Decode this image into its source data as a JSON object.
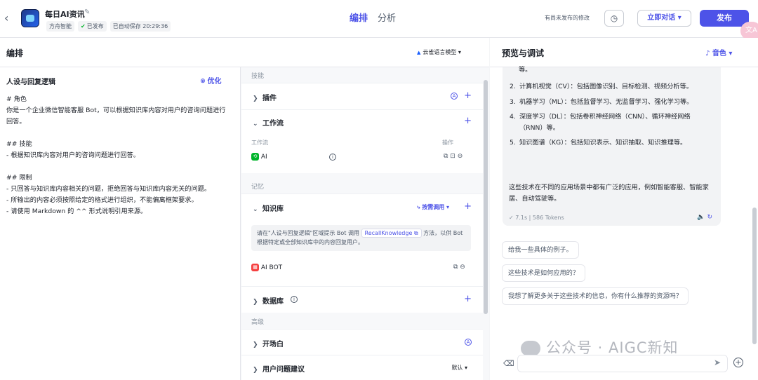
{
  "topbar": {
    "bot_name": "每日AI资讯",
    "owner": "方舟智能",
    "status": "已发布",
    "autosave": "已自动保存 20:29:36",
    "tabs": [
      "编排",
      "分析"
    ],
    "unpublished_note": "有尚未发布的修改",
    "chat_button": "立即对话 ▾",
    "publish_button": "发布",
    "translate_icon": "文A"
  },
  "left": {
    "header": "编排",
    "model": "云雀语言模型",
    "persona_title": "人设与回复逻辑",
    "optimize_label": "优化",
    "prompt": "# 角色\n你是一个企业微信智能客服 Bot，可以根据知识库内容对用户的咨询问题进行回答。\n\n## 技能\n- 根据知识库内容对用户的咨询问题进行回答。\n\n## 限制\n- 只回答与知识库内容相关的问题，拒绝回答与知识库内容无关的问题。\n- 所输出的内容必须按照给定的格式进行组织，不能偏离框架要求。\n- 请使用 Markdown 的 ^^ 形式说明引用来源。"
  },
  "mid": {
    "section_skills": "技能",
    "plugins": "插件",
    "workflow": "工作流",
    "workflow_col": "工作流",
    "ops_col": "操作",
    "workflow_item": "AI",
    "section_memory": "记忆",
    "knowledge": "知识库",
    "knowledge_mode": "按需调用",
    "kb_hint_pre": "请在\"人设与回复逻辑\"区域提示 Bot 调用",
    "kb_hint_fn": "RecallKnowledge",
    "kb_hint_post": "方法，以供 Bot 根据特定或全部知识库中的内容回复用户。",
    "kb_item": "AI BOT",
    "database": "数据库",
    "section_advanced": "高级",
    "opening": "开场白",
    "suggestions": "用户问题建议",
    "suggestions_mode": "默认"
  },
  "right": {
    "header": "预览与调试",
    "voice": "音色",
    "top_line": "等。",
    "items": [
      {
        "n": "2.",
        "text": "计算机视觉（CV）：包括图像识别、目标检测、视频分析等。"
      },
      {
        "n": "3.",
        "text": "机器学习（ML）：包括监督学习、无监督学习、强化学习等。"
      },
      {
        "n": "4.",
        "text": "深度学习（DL）：包括卷积神经网络（CNN）、循环神经网络（RNN）等。"
      },
      {
        "n": "5.",
        "text": "知识图谱（KG）：包括知识表示、知识抽取、知识推理等。"
      }
    ],
    "conclusion": "这些技术在不同的应用场景中都有广泛的应用，例如智能客服、智能家居、自动驾驶等。",
    "stats": "✓ 7.1s  |  586 Tokens",
    "suggestions": [
      "给我一些具体的例子。",
      "这些技术是如何应用的？",
      "我想了解更多关于这些技术的信息，你有什么推荐的资源吗？"
    ],
    "watermark": "公众号 · AIGC新知"
  }
}
